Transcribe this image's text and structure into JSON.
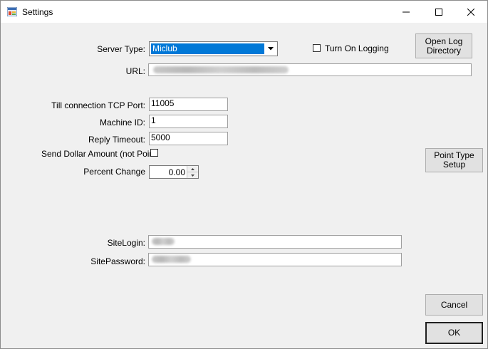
{
  "window": {
    "title": "Settings",
    "icons": {
      "app": "settings-app-icon",
      "minimize": "minimize-icon",
      "maximize": "maximize-icon",
      "close": "close-icon"
    }
  },
  "form": {
    "server_type": {
      "label": "Server Type:",
      "value": "Miclub"
    },
    "logging": {
      "label": "Turn On Logging",
      "checked": false
    },
    "open_log_button": {
      "line1": "Open Log",
      "line2": "Directory"
    },
    "url": {
      "label": "URL:",
      "value": ""
    },
    "till_port": {
      "label": "Till connection TCP Port:",
      "value": "11005"
    },
    "machine_id": {
      "label": "Machine ID:",
      "value": "1"
    },
    "reply_timeout": {
      "label": "Reply Timeout:",
      "value": "5000"
    },
    "send_dollar": {
      "label": "Send Dollar Amount (not Point",
      "checked": false
    },
    "percent_change": {
      "label": "Percent Change",
      "value": "0.00"
    },
    "point_type_button": {
      "line1": "Point Type",
      "line2": "Setup"
    },
    "site_login": {
      "label": "SiteLogin:",
      "value": ""
    },
    "site_password": {
      "label": "SitePassword:",
      "value": ""
    }
  },
  "buttons": {
    "cancel": "Cancel",
    "ok": "OK"
  },
  "colors": {
    "selection": "#0078d7",
    "window_bg": "#f0f0f0",
    "button_bg": "#e1e1e1"
  }
}
